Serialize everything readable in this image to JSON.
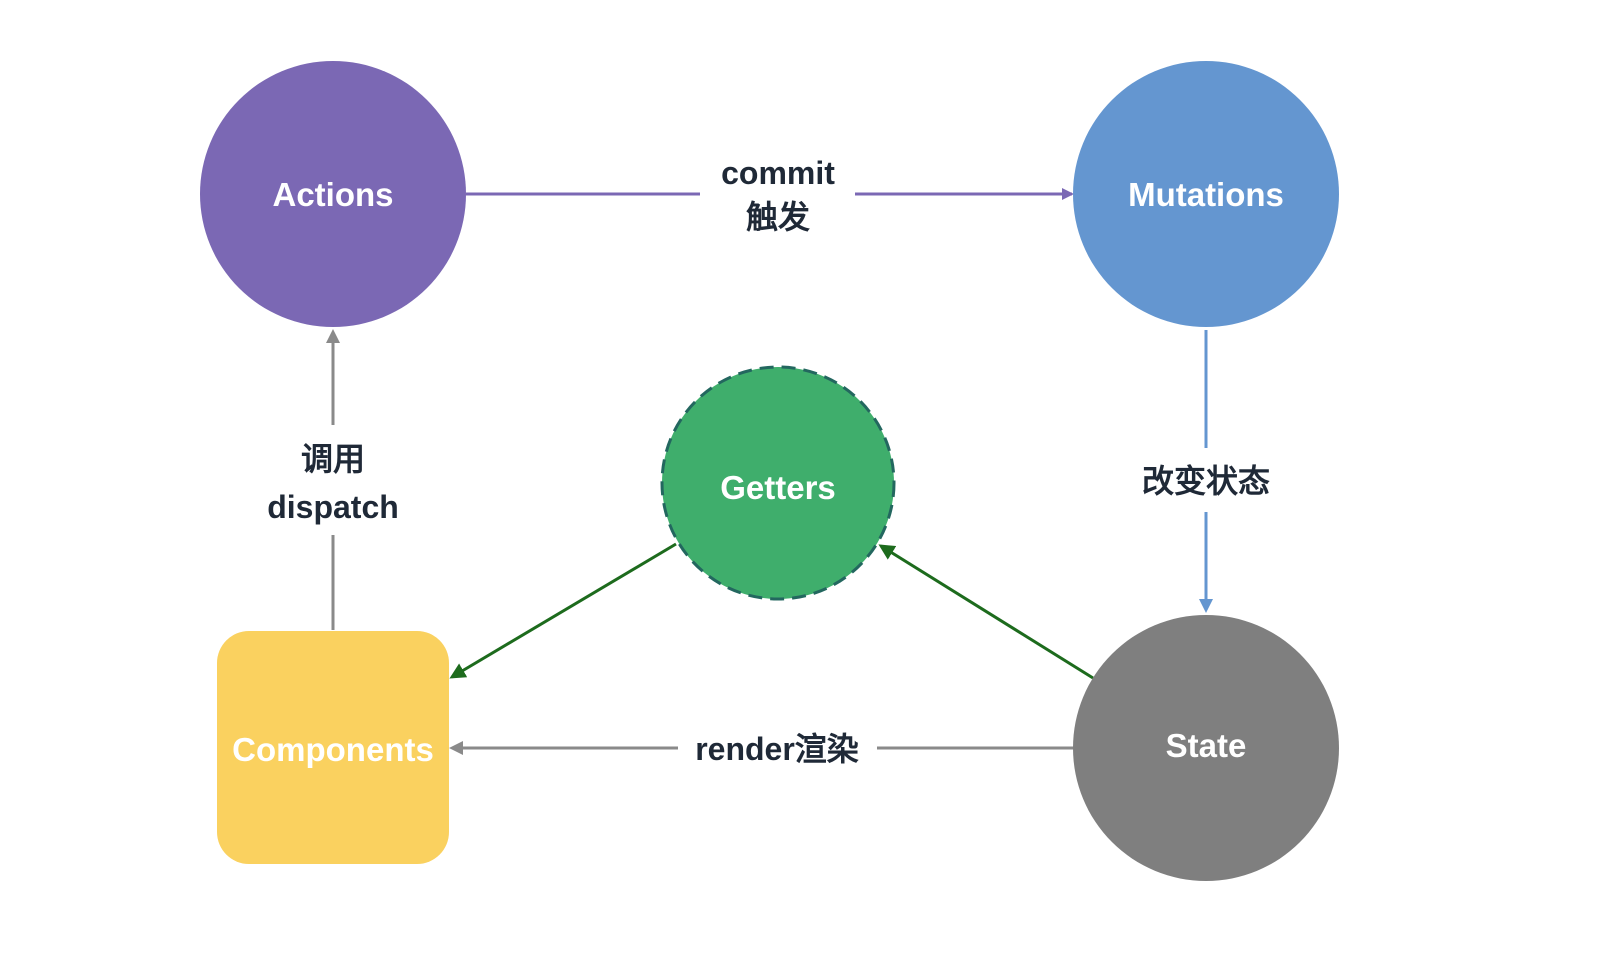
{
  "nodes": {
    "actions": {
      "label": "Actions",
      "color": "#7b68b4"
    },
    "mutations": {
      "label": "Mutations",
      "color": "#6496d0"
    },
    "getters": {
      "label": "Getters",
      "color": "#3fae6c",
      "border_color": "#23675f"
    },
    "components": {
      "label": "Components",
      "color": "#fad15f"
    },
    "state": {
      "label": "State",
      "color": "#7f7f7f"
    }
  },
  "edges": {
    "commit": {
      "line1": "commit",
      "line2": "触发",
      "color": "#7b68b4"
    },
    "mutate": {
      "label": "改变状态",
      "color": "#6496d0"
    },
    "dispatch": {
      "line1": "调用",
      "line2": "dispatch",
      "color": "#8a8a8a"
    },
    "render": {
      "label": "render渲染",
      "color": "#8a8a8a"
    },
    "getters_flow": {
      "color": "#1d6b1d"
    }
  }
}
